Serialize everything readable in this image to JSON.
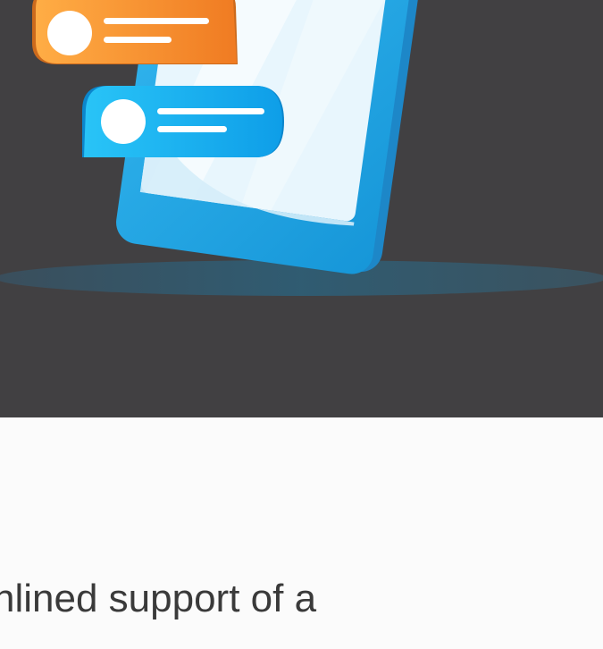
{
  "hero": {
    "illustration": "phone-chat-bubbles",
    "colors": {
      "background": "#414042",
      "phone_blue": "#29a9e8",
      "screen": "#eef8fd",
      "orange_bubble": "#f58a2a",
      "blue_bubble": "#16b3f2",
      "shadow": "#35596d"
    }
  },
  "content": {
    "line_1": "nlined support of a",
    "line_2": ""
  }
}
